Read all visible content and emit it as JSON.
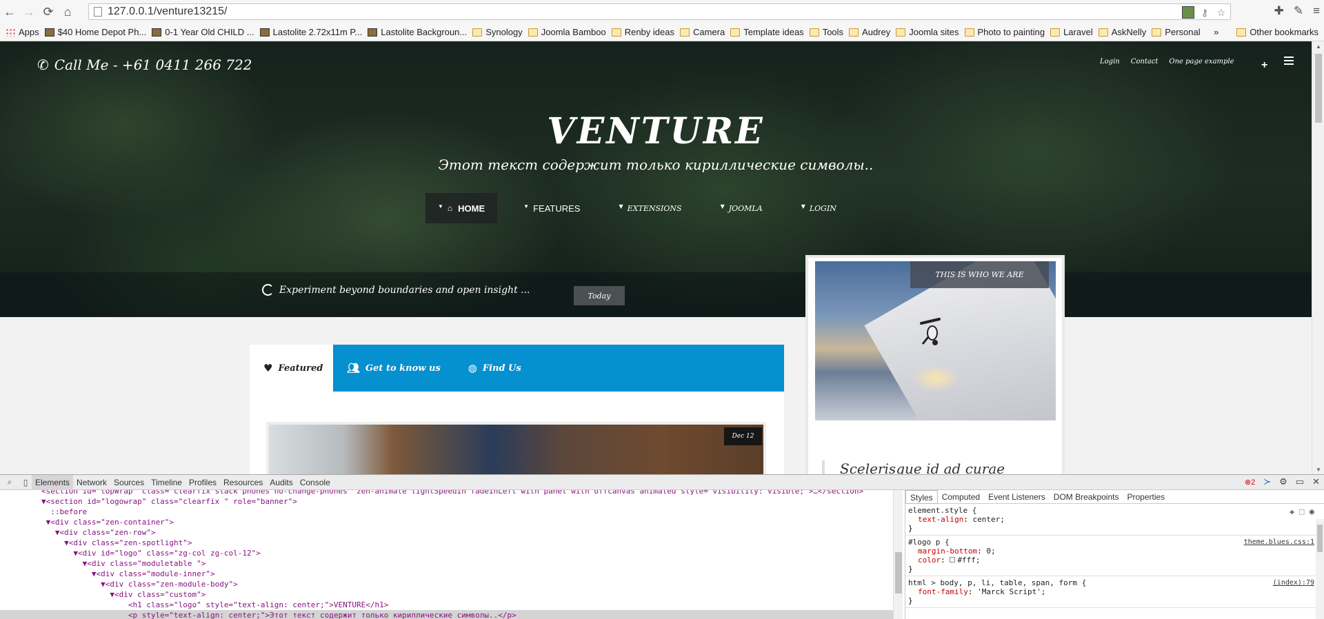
{
  "browser": {
    "url": "127.0.0.1/venture13215/",
    "bookmarks": [
      {
        "label": "Apps",
        "icon": "apps-icon"
      },
      {
        "label": "$40 Home Depot Ph...",
        "icon": "page-icon"
      },
      {
        "label": "0-1 Year Old CHILD ...",
        "icon": "page-icon"
      },
      {
        "label": "Lastolite 2.72x11m P...",
        "icon": "page-icon"
      },
      {
        "label": "Lastolite Backgroun...",
        "icon": "page-icon"
      },
      {
        "label": "Synology",
        "icon": "folder-icon"
      },
      {
        "label": "Joomla Bamboo",
        "icon": "folder-icon"
      },
      {
        "label": "Renby ideas",
        "icon": "folder-icon"
      },
      {
        "label": "Camera",
        "icon": "folder-icon"
      },
      {
        "label": "Template ideas",
        "icon": "folder-icon"
      },
      {
        "label": "Tools",
        "icon": "folder-icon"
      },
      {
        "label": "Audrey",
        "icon": "folder-icon"
      },
      {
        "label": "Joomla sites",
        "icon": "folder-icon"
      },
      {
        "label": "Photo to painting",
        "icon": "folder-icon"
      },
      {
        "label": "Laravel",
        "icon": "folder-icon"
      },
      {
        "label": "AskNelly",
        "icon": "folder-icon"
      },
      {
        "label": "Personal",
        "icon": "folder-icon"
      }
    ],
    "overflow": "»",
    "other_bookmarks": "Other bookmarks"
  },
  "site": {
    "call_me": "Call Me - +61 0411 266 722",
    "top_links": [
      "Login",
      "Contact",
      "One page example"
    ],
    "logo_title": "VENTURE",
    "logo_subtitle": "Этот текст содержит только кириллические символы..",
    "nav": [
      {
        "label": "HOME",
        "active": true
      },
      {
        "label": "FEATURES",
        "active": false
      },
      {
        "label": "EXTENSIONS",
        "active": false
      },
      {
        "label": "JOOMLA",
        "active": false
      },
      {
        "label": "LOGIN",
        "active": false
      }
    ],
    "ticker_text": "Experiment beyond boundaries and open insight ...",
    "today_label": "Today",
    "tabs": [
      {
        "label": "Featured",
        "icon": "heart-icon"
      },
      {
        "label": "Get to know us",
        "icon": "users-icon"
      },
      {
        "label": "Find Us",
        "icon": "globe-icon"
      }
    ],
    "date_badge": "Dec 12",
    "side_label": "THIS IS WHO WE ARE",
    "side_quote": "Scelerisque id ad curae",
    "colors": {
      "tab_bar": "#0590cf",
      "hero_dark": "#1e2b24"
    }
  },
  "devtools": {
    "tabs": [
      "Elements",
      "Network",
      "Sources",
      "Timeline",
      "Profiles",
      "Resources",
      "Audits",
      "Console"
    ],
    "active_tab": "Elements",
    "error_count": "2",
    "dom_lines": [
      {
        "text": "<section id=\"topWrap\" class=\"clearfix stack phones no-change-phones\" zen-animate lightSpeedIn fadeInLeft with panel with offcanvas animated style=\"visibility: visible;\">…</section>"
      },
      {
        "text": "▼<section id=\"logowrap\" class=\"clearfix \" role=\"banner\">"
      },
      {
        "text": "  ::before"
      },
      {
        "text": " ▼<div class=\"zen-container\">"
      },
      {
        "text": "   ▼<div class=\"zen-row\">"
      },
      {
        "text": "     ▼<div class=\"zen-spotlight\">"
      },
      {
        "text": "       ▼<div id=\"logo\" class=\"zg-col zg-col-12\">"
      },
      {
        "text": "         ▼<div class=\"moduletable \">"
      },
      {
        "text": "           ▼<div class=\"module-inner\">"
      },
      {
        "text": "             ▼<div class=\"zen-module-body\">"
      },
      {
        "text": "               ▼<div class=\"custom\">"
      },
      {
        "text": "                   <h1 class=\"logo\" style=\"text-align: center;\">VENTURE</h1>"
      },
      {
        "text": "                   <p style=\"text-align: center;\">Этот текст содержит только кириллические символы..</p>"
      }
    ],
    "style_tabs": [
      "Styles",
      "Computed",
      "Event Listeners",
      "DOM Breakpoints",
      "Properties"
    ],
    "rules": [
      {
        "selector": "element.style {",
        "props": [
          {
            "name": "text-align",
            "value": "center;"
          }
        ],
        "source": ""
      },
      {
        "selector": "#logo p {",
        "props": [
          {
            "name": "margin-bottom",
            "value": "0;"
          },
          {
            "name": "color",
            "value": "#fff;"
          }
        ],
        "source": "theme.blues.css:1"
      },
      {
        "selector": "html > body, p, li, table, span, form {",
        "props": [
          {
            "name": "font-family",
            "value": "'Marck Script';"
          }
        ],
        "source": "(index):79"
      }
    ]
  }
}
